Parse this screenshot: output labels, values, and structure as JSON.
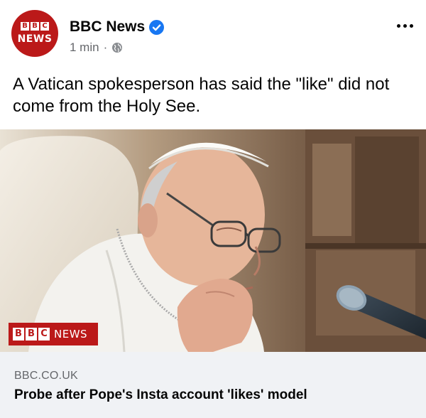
{
  "post": {
    "avatar": {
      "blocks": [
        "B",
        "B",
        "C"
      ],
      "word": "NEWS"
    },
    "page_name": "BBC News",
    "verified": true,
    "time": "1 min",
    "separator": "·",
    "audience_icon": "globe-icon",
    "more_icon": "more-options-icon",
    "caption": "A Vatican spokesperson has said the \"like\" did not come from the Holy See."
  },
  "image": {
    "description_icon": "photo",
    "badge": {
      "blocks": [
        "B",
        "B",
        "C"
      ],
      "word": "NEWS"
    }
  },
  "link_preview": {
    "domain": "BBC.CO.UK",
    "headline": "Probe after Pope's Insta account 'likes' model"
  },
  "colors": {
    "bbc_red": "#bb1919",
    "verified_blue": "#1877f2",
    "meta_gray": "#65676b",
    "card_bg": "#f0f2f5"
  }
}
